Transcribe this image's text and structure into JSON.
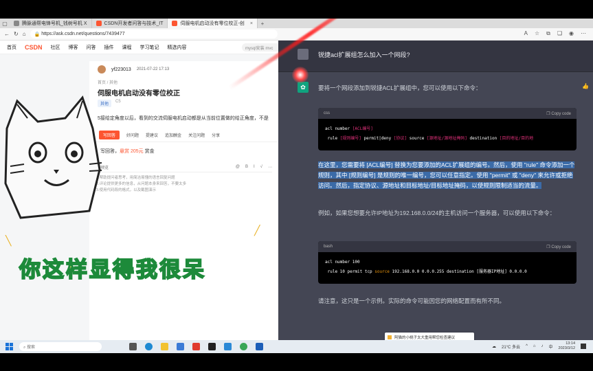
{
  "browser": {
    "tabs": [
      {
        "label": "腾脉通帮电锋号机_钱树号机 X",
        "active": false
      },
      {
        "label": "CSDN开发者问答与技术_IT",
        "active": false
      },
      {
        "label": "伺服电机启动没有零位校正-创",
        "active": true
      }
    ],
    "url": "https://ask.csdn.net/questions/7439477"
  },
  "csdn": {
    "nav": [
      "首页",
      "博客",
      "下载",
      "学习",
      "社区",
      "问答",
      "插件",
      "课程",
      "直播",
      "学习笔记",
      "精选内容"
    ],
    "logo": "CSDN",
    "search_placeholder": "mysql安装 mvc",
    "author": "yf223013",
    "date": "2021-07-22 17:13",
    "crumb": "首页 / 其他",
    "title": "伺服电机启动没有零位校正",
    "tag": "其他",
    "tag2": "C5",
    "body": "5接给定角度以后，看到的交流伺服电机启动都是从当前位置做的给正角度，不是",
    "actions": [
      "写回答",
      "好问题",
      "提建议",
      "追加酬金",
      "关注问题",
      "分享"
    ],
    "reward_prefix": "写回答，",
    "reward_value": "悬赏 205元",
    "reward_suffix": " 赏金",
    "editor_label": "预览",
    "editor_tools": [
      "@",
      "B",
      "I",
      "√",
      "⋯"
    ],
    "hints": [
      "1.帮助提问者思考，用简洁易懂的语言回复问题",
      "2.评论提供更多的信息，从问题本身来回答，不要太多",
      "3.使用代码段的格式，以及截图演示"
    ]
  },
  "meme": {
    "text": "你这样显得我很呆"
  },
  "chat": {
    "question": "锐捷acl扩展组怎么加入一个网段?",
    "intro": "要将一个网段添加到锐捷ACL扩展组中，您可以使用以下命令：",
    "code1_lang": "css",
    "copy_label": "Copy code",
    "code1_line1_pre": "acl number ",
    "code1_line1_var": "[ACL编号]",
    "code1_line2_pre": " rule ",
    "code1_line2_a": "[规则编号]",
    "code1_line2_b": " permit|deny ",
    "code1_line2_c": "[协议]",
    "code1_line2_d": " source ",
    "code1_line2_e": "[源地址/源地址掩码]",
    "code1_line2_f": " destination ",
    "code1_line2_g": "[目的地址/目的地",
    "explain": "在这里，您需要将 [ACL编号] 替换为您要添加的ACL扩展组的编号。然后，使用 \"rule\" 命令添加一个规则，其中 [规则编号] 是规则的唯一编号，您可以任意指定。使用 \"permit\" 或 \"deny\" 来允许或拒绝访问。然后，指定协议、源地址和目标地址/目标地址掩码，以使规则限制适当的流量。",
    "example": "例如，如果您想要允许IP地址为192.168.0.0/24的主机访问一个服务器，可以使用以下命令：",
    "code2_lang": "bash",
    "code2_line1": "acl number 100",
    "code2_line2_a": " rule 10 permit tcp ",
    "code2_line2_b": "source",
    "code2_line2_c": " 192.168.0.0 0.0.0.255 destination [服务器IP地址] 0.0.0.0",
    "note": "请注意，这只是一个示例。实际的命令可能因您的网络配置而有所不同。"
  },
  "taskbar": {
    "search": "搜索",
    "notification": "阿猫的小桃子太大重用帮您检查建议",
    "weather": "21°C 多云",
    "time": "13:14",
    "date": "2023/3/12",
    "lang": "中"
  },
  "colors": {
    "csdn_red": "#fc5531",
    "gpt_green": "#10a37f",
    "chat_bg": "#444654"
  }
}
